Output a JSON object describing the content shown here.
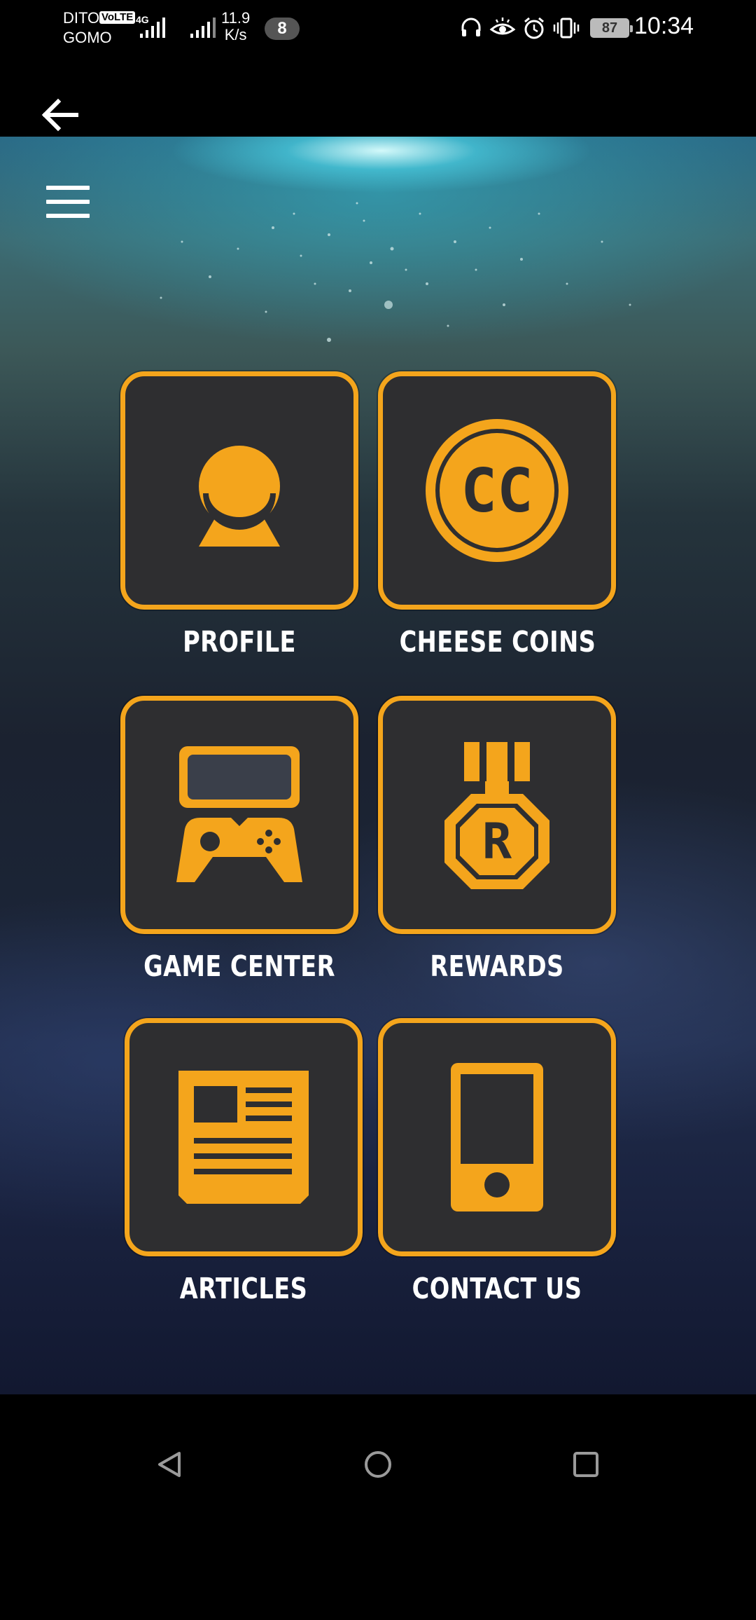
{
  "status_bar": {
    "carrier_line1": "DITO",
    "carrier_line2": "GOMO",
    "volte": "VoLTE",
    "network": "4G",
    "speed_value": "11.9",
    "speed_unit": "K/s",
    "notification_count": "8",
    "battery": "87",
    "time": "10:34"
  },
  "menu_tiles": [
    {
      "label": "PROFILE",
      "icon": "profile-icon"
    },
    {
      "label": "CHEESE COINS",
      "icon": "cheese-coin-icon",
      "icon_text": "CC"
    },
    {
      "label": "GAME CENTER",
      "icon": "game-controller-icon"
    },
    {
      "label": "REWARDS",
      "icon": "reward-medal-icon",
      "icon_text": "R"
    },
    {
      "label": "ARTICLES",
      "icon": "newspaper-icon"
    },
    {
      "label": "CONTACT US",
      "icon": "phone-icon"
    }
  ],
  "colors": {
    "accent": "#f4a51c",
    "tile_background": "#2e2e30"
  }
}
